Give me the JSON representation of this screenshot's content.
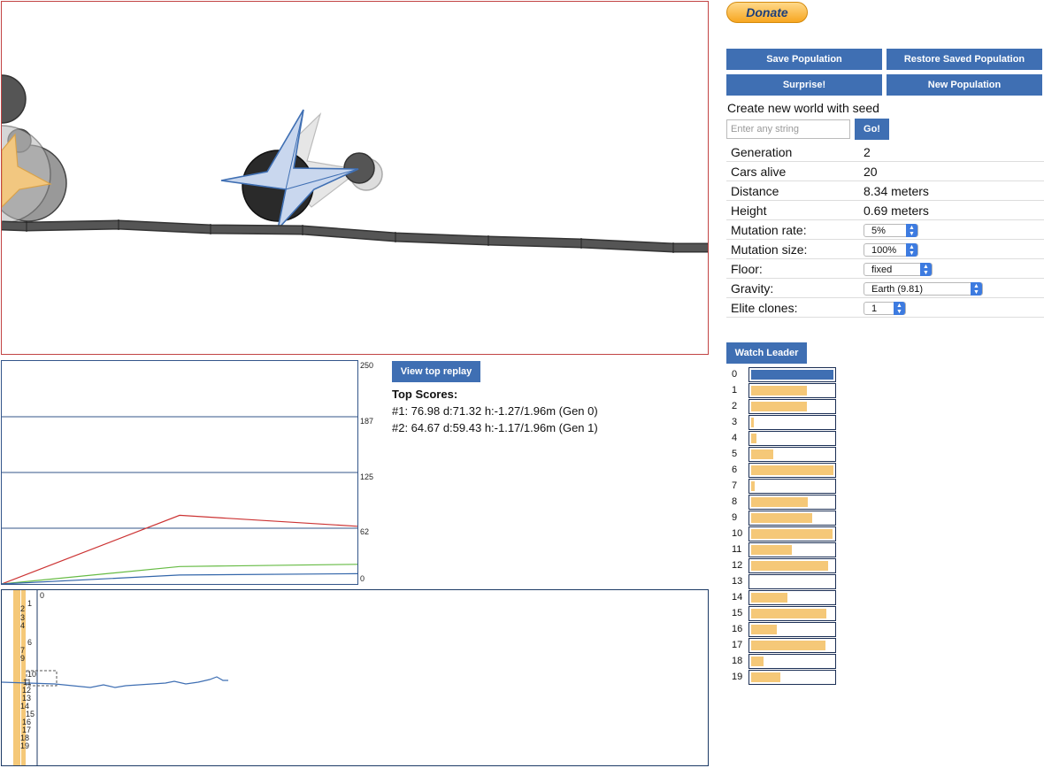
{
  "donate_label": "Donate",
  "buttons": {
    "save_population": "Save Population",
    "restore_saved_population": "Restore Saved Population",
    "surprise": "Surprise!",
    "new_population": "New Population",
    "go": "Go!",
    "view_top_replay": "View top replay",
    "watch_leader": "Watch Leader"
  },
  "seed": {
    "label": "Create new world with seed",
    "placeholder": "Enter any string"
  },
  "stats": {
    "generation_label": "Generation",
    "generation_value": "2",
    "cars_alive_label": "Cars alive",
    "cars_alive_value": "20",
    "distance_label": "Distance",
    "distance_value": "8.34 meters",
    "height_label": "Height",
    "height_value": "0.69 meters",
    "mutation_rate_label": "Mutation rate:",
    "mutation_rate_value": "5%",
    "mutation_size_label": "Mutation size:",
    "mutation_size_value": "100%",
    "floor_label": "Floor:",
    "floor_value": "fixed",
    "gravity_label": "Gravity:",
    "gravity_value": "Earth (9.81)",
    "elite_clones_label": "Elite clones:",
    "elite_clones_value": "1"
  },
  "graph": {
    "y_ticks": [
      "250",
      "187",
      "125",
      "62",
      "0"
    ]
  },
  "top_scores": {
    "title": "Top Scores:",
    "entries": [
      "#1: 76.98 d:71.32 h:-1.27/1.96m (Gen 0)",
      "#2: 64.67 d:59.43 h:-1.17/1.96m (Gen 1)"
    ]
  },
  "chart_data": {
    "type": "line",
    "x": [
      0,
      1,
      2
    ],
    "ylim": [
      0,
      250
    ],
    "series": [
      {
        "color": "#cc3333",
        "values": [
          0,
          76.98,
          64.67
        ]
      },
      {
        "color": "#66bb44",
        "values": [
          0,
          19.5,
          22
        ]
      },
      {
        "color": "#3366aa",
        "values": [
          0,
          10,
          11.5
        ]
      }
    ]
  },
  "minimap": {
    "top_label": "0",
    "labels": [
      "1",
      "2",
      "3",
      "4",
      "5",
      "6",
      "7",
      "8",
      "9",
      "10",
      "11",
      "12",
      "13",
      "14",
      "15",
      "16",
      "17",
      "18",
      "19"
    ]
  },
  "health": {
    "accent": "#3f6fb3",
    "bar_color": "#f5c878",
    "cars": [
      {
        "label": "0",
        "health": 1.0,
        "leader": true
      },
      {
        "label": "1",
        "health": 0.68
      },
      {
        "label": "2",
        "health": 0.68
      },
      {
        "label": "3",
        "health": 0.03
      },
      {
        "label": "4",
        "health": 0.06
      },
      {
        "label": "5",
        "health": 0.27
      },
      {
        "label": "6",
        "health": 1.0
      },
      {
        "label": "7",
        "health": 0.04
      },
      {
        "label": "8",
        "health": 0.69
      },
      {
        "label": "9",
        "health": 0.74
      },
      {
        "label": "10",
        "health": 0.99
      },
      {
        "label": "11",
        "health": 0.49
      },
      {
        "label": "12",
        "health": 0.94
      },
      {
        "label": "13",
        "health": 0.0
      },
      {
        "label": "14",
        "health": 0.44
      },
      {
        "label": "15",
        "health": 0.91
      },
      {
        "label": "16",
        "health": 0.31
      },
      {
        "label": "17",
        "health": 0.9
      },
      {
        "label": "18",
        "health": 0.15
      },
      {
        "label": "19",
        "health": 0.35
      }
    ]
  }
}
